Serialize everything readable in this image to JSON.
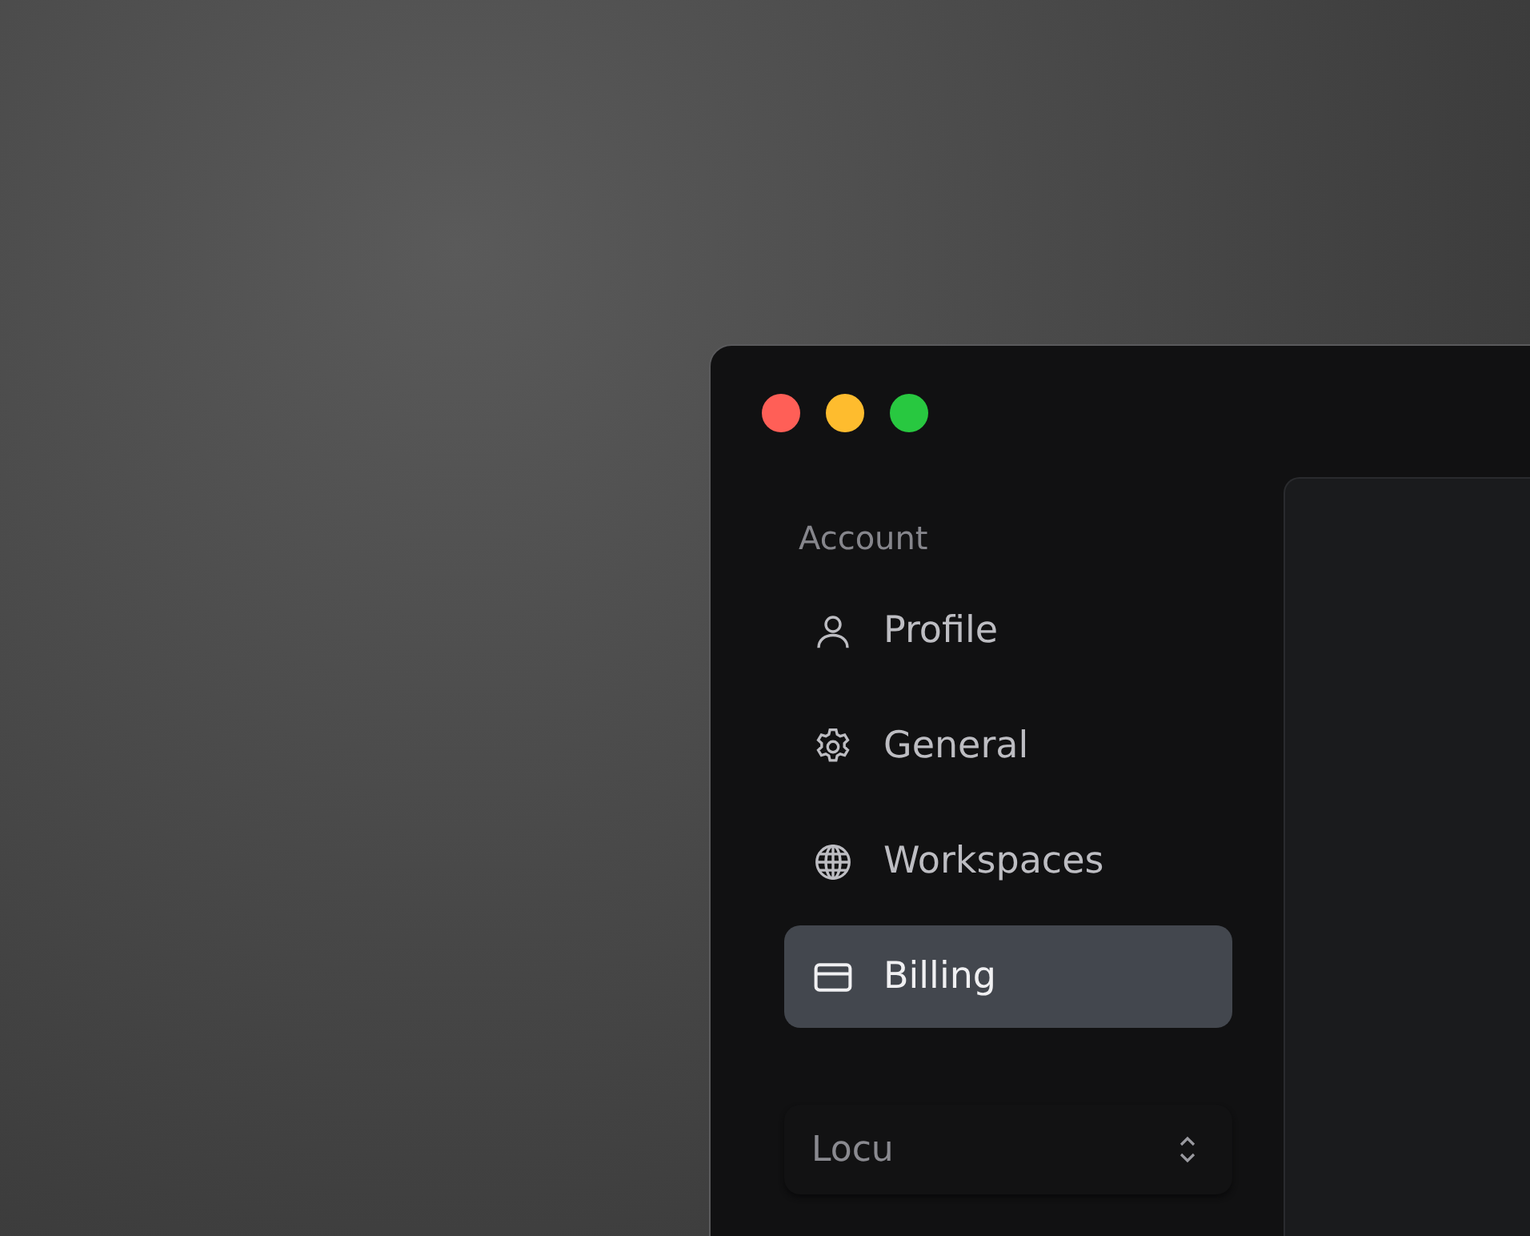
{
  "sidebar": {
    "section_title": "Account",
    "items": [
      {
        "label": "Profile",
        "selected": false
      },
      {
        "label": "General",
        "selected": false
      },
      {
        "label": "Workspaces",
        "selected": false
      },
      {
        "label": "Billing",
        "selected": true
      }
    ],
    "workspace_selector": {
      "value": "Locu"
    }
  }
}
